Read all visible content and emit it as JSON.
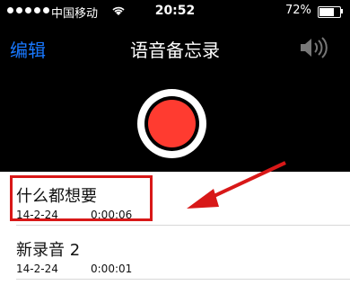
{
  "statusbar": {
    "carrier": "中国移动",
    "time": "20:52",
    "battery_percent": "72%",
    "battery_level": 0.72,
    "signal_bars_filled": 5
  },
  "nav": {
    "edit_label": "编辑",
    "title": "语音备忘录",
    "speaker_icon": "speaker-icon"
  },
  "record_button": {
    "icon": "record-icon",
    "color": "#ff3b30"
  },
  "recordings": [
    {
      "title": "什么都想要",
      "date": "14-2-24",
      "duration": "0:00:06",
      "highlighted": true
    },
    {
      "title": "新录音 2",
      "date": "14-2-24",
      "duration": "0:00:01",
      "highlighted": false
    }
  ],
  "annotation": {
    "highlight_color": "#d81818",
    "arrow_icon": "arrow-icon"
  },
  "colors": {
    "accent": "#1878ff",
    "background_top": "#000000"
  }
}
